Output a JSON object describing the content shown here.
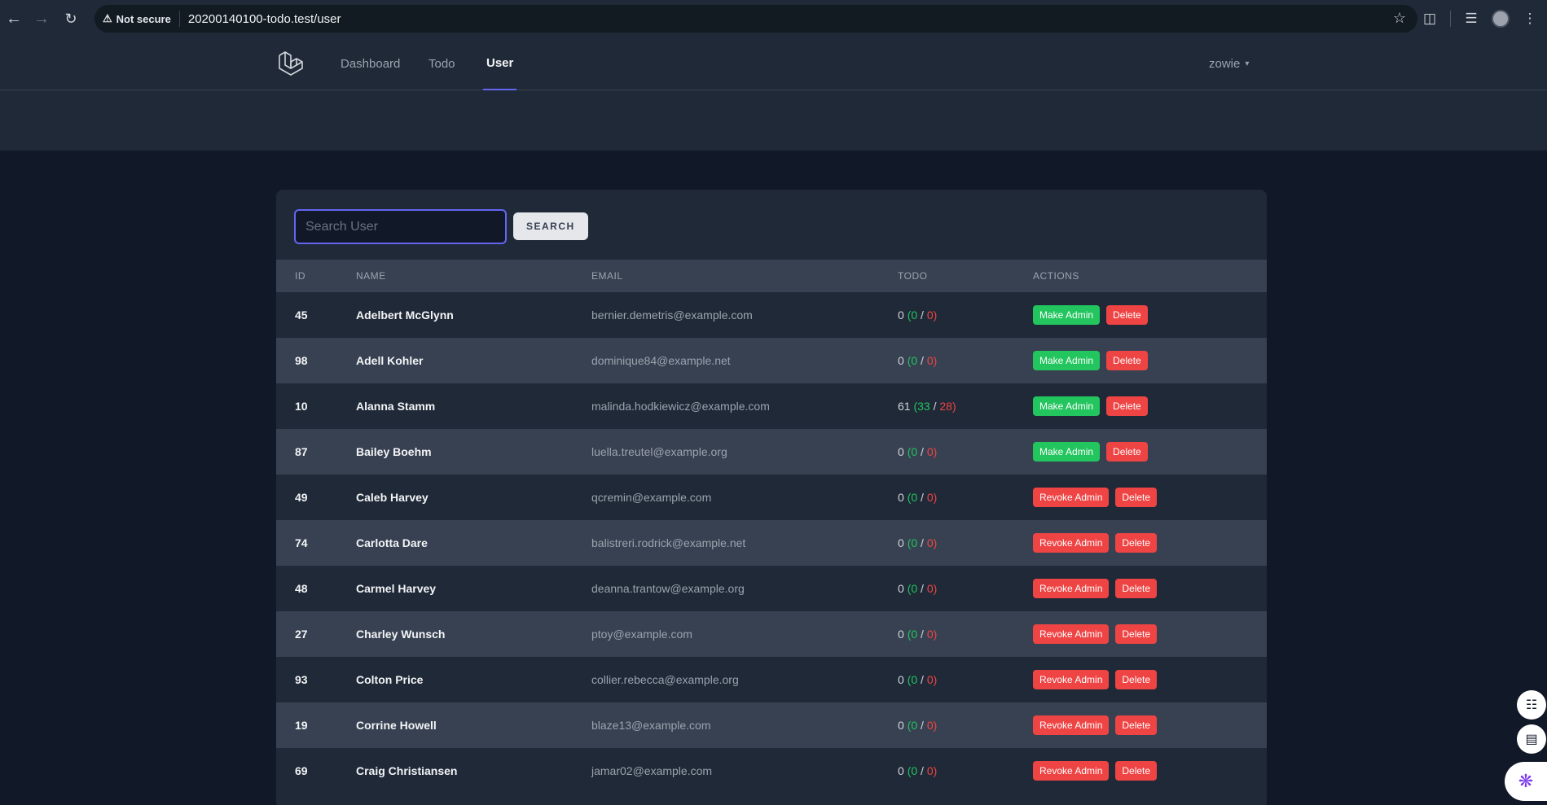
{
  "browser": {
    "security_label": "Not secure",
    "url": "20200140100-todo.test/user"
  },
  "nav": {
    "links": [
      "Dashboard",
      "Todo",
      "User"
    ],
    "active": "User",
    "user_name": "zowie"
  },
  "search": {
    "placeholder": "Search User",
    "button_label": "SEARCH"
  },
  "table": {
    "headers": [
      "ID",
      "NAME",
      "EMAIL",
      "TODO",
      "ACTIONS"
    ],
    "rows": [
      {
        "id": "45",
        "name": "Adelbert McGlynn",
        "email": "bernier.demetris@example.com",
        "total": "0",
        "done": "0",
        "pending": "0",
        "admin_action": "Make Admin",
        "delete": "Delete"
      },
      {
        "id": "98",
        "name": "Adell Kohler",
        "email": "dominique84@example.net",
        "total": "0",
        "done": "0",
        "pending": "0",
        "admin_action": "Make Admin",
        "delete": "Delete"
      },
      {
        "id": "10",
        "name": "Alanna Stamm",
        "email": "malinda.hodkiewicz@example.com",
        "total": "61",
        "done": "33",
        "pending": "28",
        "admin_action": "Make Admin",
        "delete": "Delete"
      },
      {
        "id": "87",
        "name": "Bailey Boehm",
        "email": "luella.treutel@example.org",
        "total": "0",
        "done": "0",
        "pending": "0",
        "admin_action": "Make Admin",
        "delete": "Delete"
      },
      {
        "id": "49",
        "name": "Caleb Harvey",
        "email": "qcremin@example.com",
        "total": "0",
        "done": "0",
        "pending": "0",
        "admin_action": "Revoke Admin",
        "delete": "Delete"
      },
      {
        "id": "74",
        "name": "Carlotta Dare",
        "email": "balistreri.rodrick@example.net",
        "total": "0",
        "done": "0",
        "pending": "0",
        "admin_action": "Revoke Admin",
        "delete": "Delete"
      },
      {
        "id": "48",
        "name": "Carmel Harvey",
        "email": "deanna.trantow@example.org",
        "total": "0",
        "done": "0",
        "pending": "0",
        "admin_action": "Revoke Admin",
        "delete": "Delete"
      },
      {
        "id": "27",
        "name": "Charley Wunsch",
        "email": "ptoy@example.com",
        "total": "0",
        "done": "0",
        "pending": "0",
        "admin_action": "Revoke Admin",
        "delete": "Delete"
      },
      {
        "id": "93",
        "name": "Colton Price",
        "email": "collier.rebecca@example.org",
        "total": "0",
        "done": "0",
        "pending": "0",
        "admin_action": "Revoke Admin",
        "delete": "Delete"
      },
      {
        "id": "19",
        "name": "Corrine Howell",
        "email": "blaze13@example.com",
        "total": "0",
        "done": "0",
        "pending": "0",
        "admin_action": "Revoke Admin",
        "delete": "Delete"
      },
      {
        "id": "69",
        "name": "Craig Christiansen",
        "email": "jamar02@example.com",
        "total": "0",
        "done": "0",
        "pending": "0",
        "admin_action": "Revoke Admin",
        "delete": "Delete"
      }
    ]
  },
  "colors": {
    "accent": "#6366f1",
    "success": "#22c55e",
    "danger": "#ef4444",
    "page_bg": "#111827",
    "panel_bg": "#1f2937"
  }
}
